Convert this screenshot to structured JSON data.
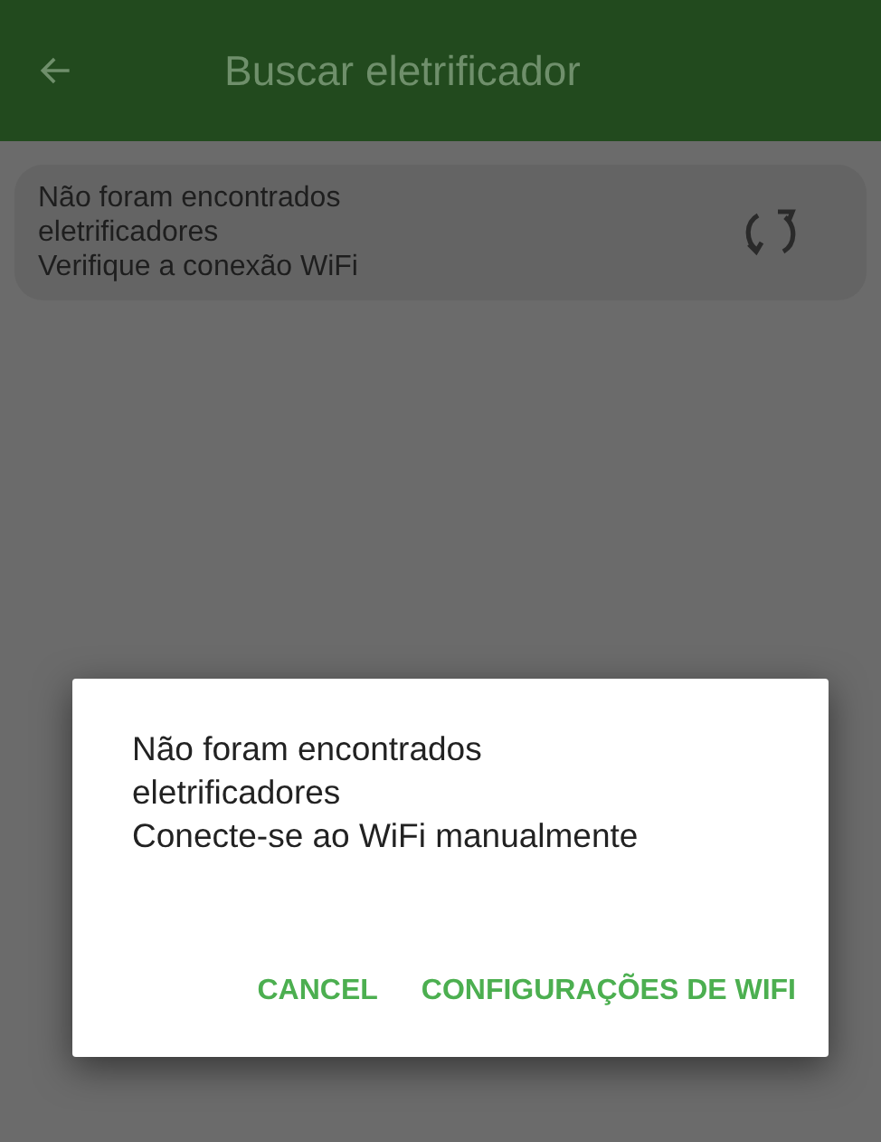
{
  "toolbar": {
    "title": "Buscar eletrificador"
  },
  "status_card": {
    "lines": [
      "Não foram encontrados",
      "eletrificadores",
      "Verifique a conexão WiFi"
    ]
  },
  "dialog": {
    "lines": [
      "Não foram encontrados",
      "eletrificadores",
      "Conecte-se ao WiFi manualmente"
    ],
    "buttons": [
      "CANCEL",
      "CONFIGURAÇÕES DE WIFI"
    ]
  }
}
